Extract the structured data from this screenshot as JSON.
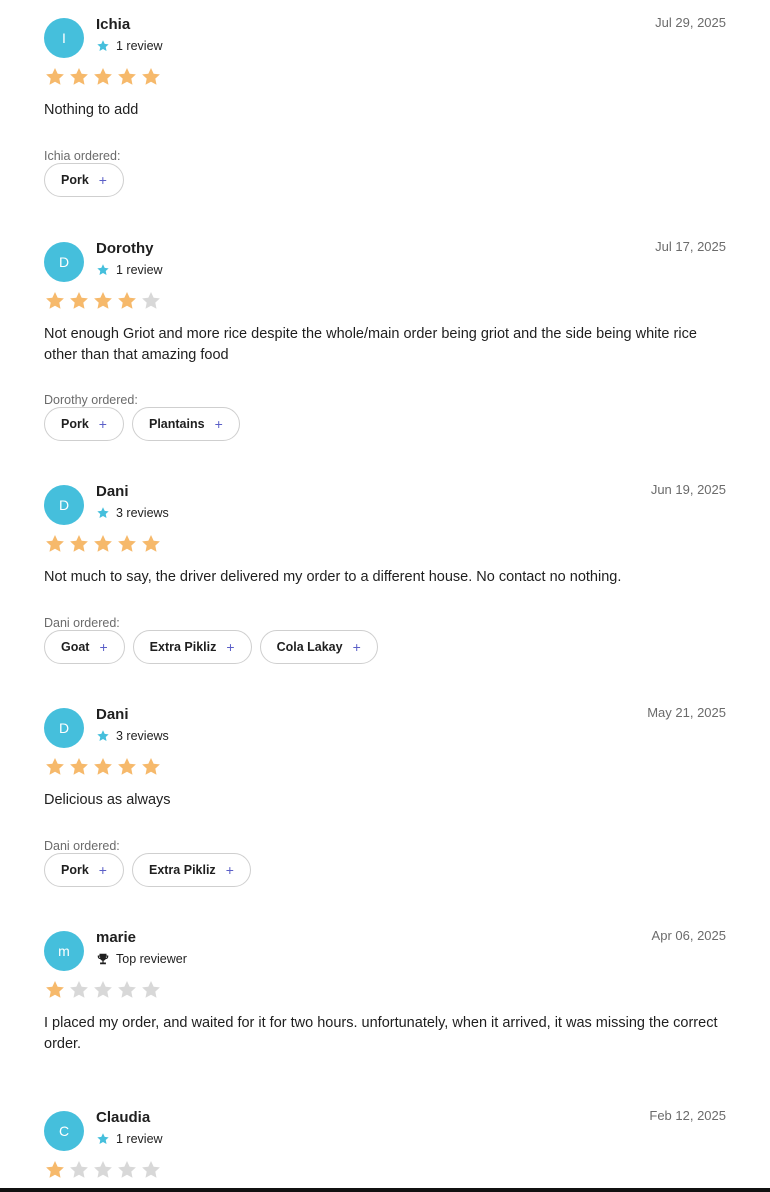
{
  "colors": {
    "avatar": "#45bfdc",
    "star_filled": "#f6b96b",
    "star_empty": "#d8d8d8",
    "plus_accent": "#5b5fc7"
  },
  "reviews": [
    {
      "initial": "I",
      "author": "Ichia",
      "meta_icon": "star-icon",
      "meta_text": "1 review",
      "date": "Jul 29, 2025",
      "rating": 5,
      "text": "Nothing to add",
      "ordered_label": "Ichia ordered:",
      "items": [
        "Pork"
      ]
    },
    {
      "initial": "D",
      "author": "Dorothy",
      "meta_icon": "star-icon",
      "meta_text": "1 review",
      "date": "Jul 17, 2025",
      "rating": 4,
      "text": "Not enough Griot and more rice despite the whole/main order being griot and the side being white rice other than that amazing food",
      "ordered_label": "Dorothy ordered:",
      "items": [
        "Pork",
        "Plantains"
      ]
    },
    {
      "initial": "D",
      "author": "Dani",
      "meta_icon": "star-icon",
      "meta_text": "3 reviews",
      "date": "Jun 19, 2025",
      "rating": 5,
      "text": "Not much to say, the driver delivered my order to a different house. No contact no nothing.",
      "ordered_label": "Dani ordered:",
      "items": [
        "Goat",
        "Extra Pikliz",
        "Cola Lakay"
      ]
    },
    {
      "initial": "D",
      "author": "Dani",
      "meta_icon": "star-icon",
      "meta_text": "3 reviews",
      "date": "May 21, 2025",
      "rating": 5,
      "text": "Delicious as always",
      "ordered_label": "Dani ordered:",
      "items": [
        "Pork",
        "Extra Pikliz"
      ]
    },
    {
      "initial": "m",
      "author": "marie",
      "meta_icon": "trophy-icon",
      "meta_text": "Top reviewer",
      "date": "Apr 06, 2025",
      "rating": 1,
      "text": "I placed my order, and waited for it for two hours. unfortunately, when it arrived, it was missing the correct order.",
      "ordered_label": "",
      "items": []
    },
    {
      "initial": "C",
      "author": "Claudia",
      "meta_icon": "star-icon",
      "meta_text": "1 review",
      "date": "Feb 12, 2025",
      "rating": 1,
      "text": "",
      "ordered_label": "",
      "items": []
    }
  ]
}
